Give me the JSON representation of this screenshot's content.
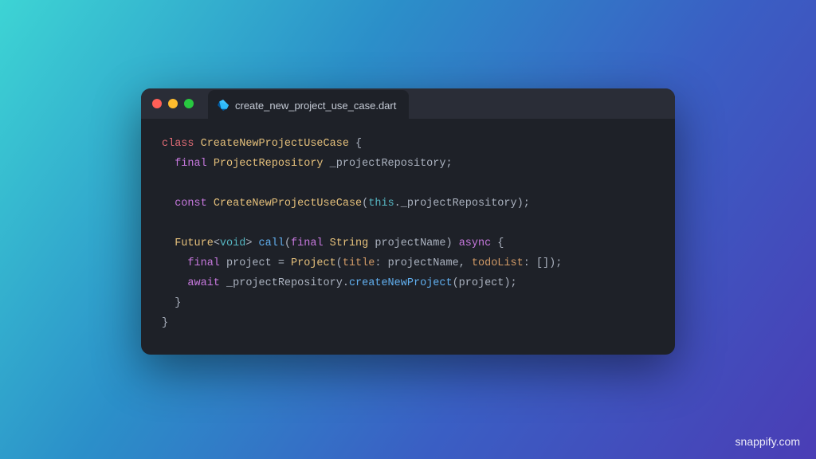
{
  "tab": {
    "title": "create_new_project_use_case.dart"
  },
  "code": {
    "tokens": [
      [
        {
          "t": "class ",
          "c": "kw-red"
        },
        {
          "t": "CreateNewProjectUseCase",
          "c": "type"
        },
        {
          "t": " {",
          "c": "punct"
        }
      ],
      [
        {
          "t": "  final ",
          "c": "kw-purple"
        },
        {
          "t": "ProjectRepository",
          "c": "type"
        },
        {
          "t": " _projectRepository;",
          "c": "ident"
        }
      ],
      [],
      [
        {
          "t": "  const ",
          "c": "kw-purple"
        },
        {
          "t": "CreateNewProjectUseCase",
          "c": "type"
        },
        {
          "t": "(",
          "c": "punct"
        },
        {
          "t": "this",
          "c": "built"
        },
        {
          "t": "._projectRepository);",
          "c": "ident"
        }
      ],
      [],
      [
        {
          "t": "  Future",
          "c": "type"
        },
        {
          "t": "<",
          "c": "punct"
        },
        {
          "t": "void",
          "c": "built"
        },
        {
          "t": "> ",
          "c": "punct"
        },
        {
          "t": "call",
          "c": "fn"
        },
        {
          "t": "(",
          "c": "punct"
        },
        {
          "t": "final ",
          "c": "kw-purple"
        },
        {
          "t": "String",
          "c": "type"
        },
        {
          "t": " projectName) ",
          "c": "ident"
        },
        {
          "t": "async",
          "c": "kw-purple"
        },
        {
          "t": " {",
          "c": "punct"
        }
      ],
      [
        {
          "t": "    final ",
          "c": "kw-purple"
        },
        {
          "t": "project = ",
          "c": "ident"
        },
        {
          "t": "Project",
          "c": "type"
        },
        {
          "t": "(",
          "c": "punct"
        },
        {
          "t": "title",
          "c": "param"
        },
        {
          "t": ": projectName, ",
          "c": "ident"
        },
        {
          "t": "todoList",
          "c": "param"
        },
        {
          "t": ": []);",
          "c": "ident"
        }
      ],
      [
        {
          "t": "    await ",
          "c": "kw-purple"
        },
        {
          "t": "_projectRepository.",
          "c": "ident"
        },
        {
          "t": "createNewProject",
          "c": "fn"
        },
        {
          "t": "(project);",
          "c": "ident"
        }
      ],
      [
        {
          "t": "  }",
          "c": "punct"
        }
      ],
      [
        {
          "t": "}",
          "c": "punct"
        }
      ]
    ]
  },
  "watermark": "snappify.com"
}
